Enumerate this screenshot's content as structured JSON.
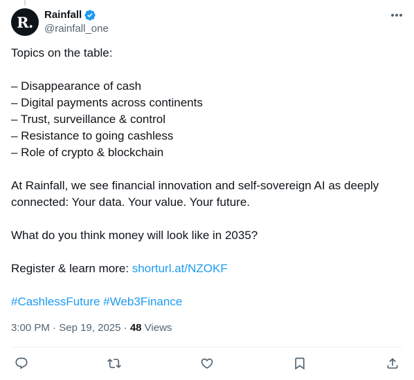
{
  "author": {
    "display_name": "Rainfall",
    "handle": "@rainfall_one",
    "avatar_text": "R."
  },
  "tweet": {
    "intro": "Topics on the table:",
    "topics": [
      "– Disappearance of cash",
      "– Digital payments across continents",
      "– Trust, surveillance & control",
      "– Resistance to going cashless",
      "– Role of crypto & blockchain"
    ],
    "statement": "At Rainfall, we see financial innovation and self-sovereign AI as deeply connected: Your data. Your value. Your future.",
    "question": "What do you think money will look like in 2035?",
    "register_prefix": "Register & learn more: ",
    "register_link": "shorturl.at/NZOKF",
    "hashtags": [
      "#CashlessFuture",
      "#Web3Finance"
    ]
  },
  "meta": {
    "time": "3:00 PM",
    "date": "Sep 19, 2025",
    "views_count": "48",
    "views_label": "Views"
  },
  "colors": {
    "link": "#1d9bf0",
    "verified": "#1d9bf0",
    "text": "#0f1419",
    "muted": "#536471"
  }
}
